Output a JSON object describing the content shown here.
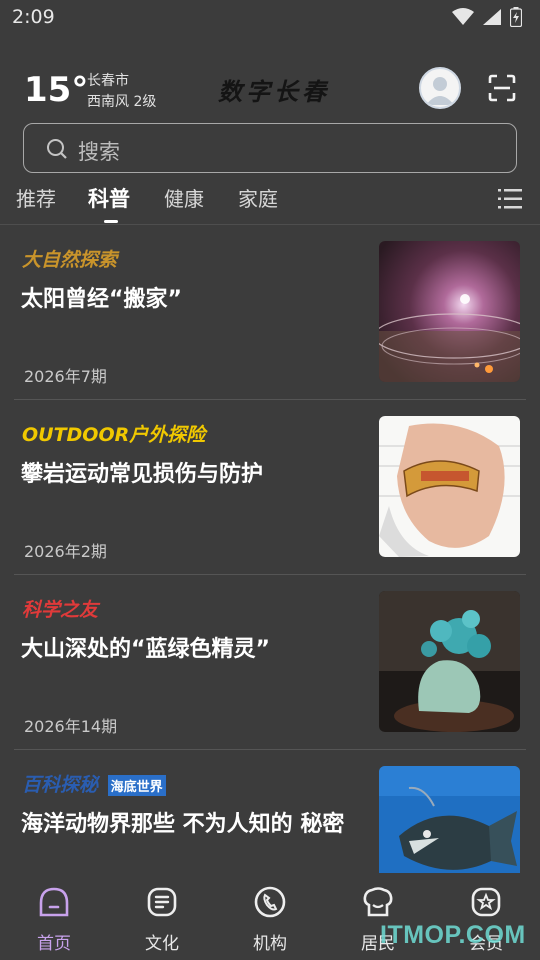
{
  "status_bar": {
    "time": "2:09"
  },
  "header": {
    "temperature": "15°",
    "city": "长春市",
    "wind": "西南风 2级",
    "logo_text": "数字长春"
  },
  "search": {
    "placeholder": "搜索"
  },
  "tabs": [
    {
      "label": "推荐",
      "active": false
    },
    {
      "label": "科普",
      "active": true
    },
    {
      "label": "健康",
      "active": false
    },
    {
      "label": "家庭",
      "active": false
    }
  ],
  "articles": [
    {
      "source": "大自然探索",
      "source_color": "#c9942b",
      "title": "太阳曾经“搬家”",
      "issue": "2026年7期",
      "image": "galaxy"
    },
    {
      "source": "OUTDOOR户外探险",
      "source_color": "#f0c800",
      "title": "攀岩运动常见损伤与防护",
      "issue": "2026年2期",
      "image": "climbing-hand"
    },
    {
      "source": "科学之友",
      "source_color": "#e03a3a",
      "title": "大山深处的“蓝绿色精灵”",
      "issue": "2026年14期",
      "image": "turquoise-carving"
    },
    {
      "source": "百科探秘",
      "source_color": "#2a5db0",
      "source_badge": "海底世界",
      "title": "海洋动物界那些 不为人知的 秘密",
      "issue": "",
      "image": "anglerfish"
    }
  ],
  "bottom_nav": [
    {
      "label": "首页",
      "icon": "home-icon",
      "active": true
    },
    {
      "label": "文化",
      "icon": "culture-icon",
      "active": false
    },
    {
      "label": "机构",
      "icon": "phone-icon",
      "active": false
    },
    {
      "label": "居民",
      "icon": "residents-icon",
      "active": false
    },
    {
      "label": "会员",
      "icon": "member-star-icon",
      "active": false
    }
  ],
  "watermark": "ITMOP.COM",
  "colors": {
    "background": "#3c3c3c",
    "active_nav": "#c8a2ec",
    "divider": "#555555"
  }
}
